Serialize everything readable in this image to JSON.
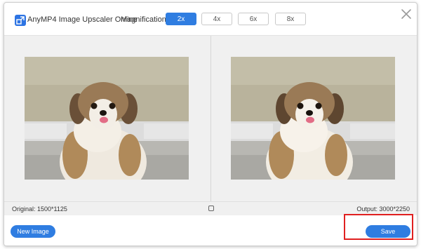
{
  "app": {
    "title": "AnyMP4 Image Upscaler Online"
  },
  "magnification": {
    "label": "Magnification:",
    "options": [
      "2x",
      "4x",
      "6x",
      "8x"
    ],
    "selected": "2x"
  },
  "preview": {
    "original_label": "Original: 1500*1125",
    "output_label": "Output: 3000*2250"
  },
  "footer": {
    "new_image_label": "New Image",
    "save_label": "Save"
  },
  "icons": {
    "logo": "image-upscale-icon",
    "close": "close-icon",
    "compare": "compare-icon"
  },
  "colors": {
    "accent": "#2f7de1",
    "highlight": "#e02020"
  }
}
